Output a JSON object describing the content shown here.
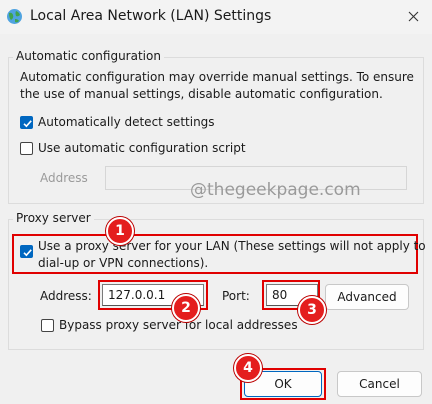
{
  "window": {
    "title": "Local Area Network (LAN) Settings",
    "icons": {
      "app": "network-globe-icon",
      "close": "close-icon"
    }
  },
  "auto_config": {
    "group_label": "Automatic configuration",
    "description_line1": "Automatic configuration may override manual settings.  To ensure",
    "description_line2": "the use of manual settings, disable automatic configuration.",
    "detect_label": "Automatically detect settings",
    "detect_checked": true,
    "script_label": "Use automatic configuration script",
    "script_checked": false,
    "address_label": "Address",
    "address_value": ""
  },
  "watermark": "@thegeekpage.com",
  "proxy": {
    "group_label": "Proxy server",
    "use_proxy_label_line1": "Use a proxy server for your LAN (These settings will not apply to",
    "use_proxy_label_line2": "dial-up or VPN connections).",
    "use_proxy_checked": true,
    "address_label": "Address:",
    "address_value": "127.0.0.1",
    "port_label": "Port:",
    "port_value": "80",
    "advanced_label": "Advanced",
    "bypass_label": "Bypass proxy server for local addresses",
    "bypass_checked": false
  },
  "buttons": {
    "ok": "OK",
    "cancel": "Cancel"
  },
  "annotations": {
    "badge1": "1",
    "badge2": "2",
    "badge3": "3",
    "badge4": "4",
    "color": "#e41e1e"
  }
}
